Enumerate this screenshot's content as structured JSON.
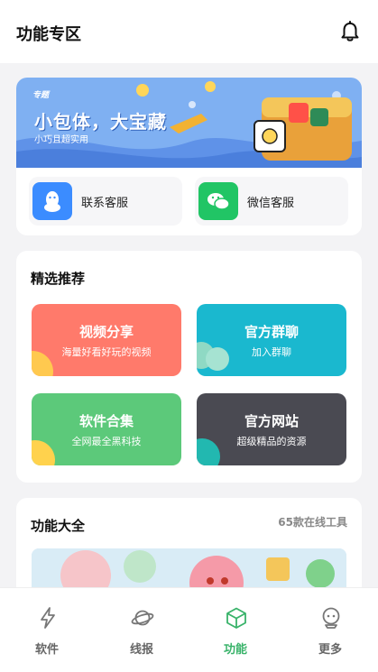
{
  "header": {
    "title": "功能专区"
  },
  "banner": {
    "tag": "专题",
    "headline": "小包体，大宝藏",
    "subline": "小巧且超实用"
  },
  "services": [
    {
      "label": "联系客服",
      "color": "#3b8cff"
    },
    {
      "label": "微信客服",
      "color": "#21c565"
    }
  ],
  "featured": {
    "title": "精选推荐",
    "tiles": [
      {
        "title": "视频分享",
        "subtitle": "海量好看好玩的视频",
        "color": "#ff7a6b"
      },
      {
        "title": "官方群聊",
        "subtitle": "加入群聊",
        "color": "#1ab8cf"
      },
      {
        "title": "软件合集",
        "subtitle": "全网最全黑科技",
        "color": "#5cc97a"
      },
      {
        "title": "官方网站",
        "subtitle": "超级精品的资源",
        "color": "#4a4a52"
      }
    ]
  },
  "tools": {
    "title": "功能大全",
    "count_text": "65款在线工具"
  },
  "tabs": [
    {
      "label": "软件",
      "icon": "lightning-icon"
    },
    {
      "label": "线报",
      "icon": "planet-icon"
    },
    {
      "label": "功能",
      "icon": "cube-icon",
      "active": true
    },
    {
      "label": "更多",
      "icon": "robot-icon"
    }
  ],
  "colors": {
    "accent": "#39b36a",
    "background": "#f3f3f5"
  }
}
